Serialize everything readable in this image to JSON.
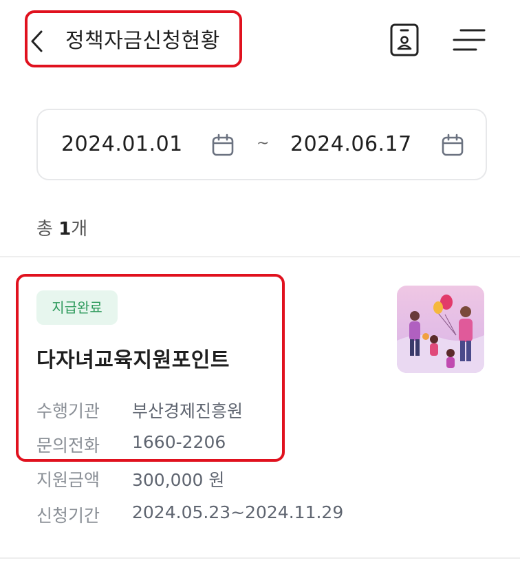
{
  "header": {
    "title": "정책자금신청현황",
    "back_icon": "chevron-left-icon",
    "id_card_icon": "id-card-icon",
    "menu_icon": "menu-icon",
    "highlight_color": "#e0111e"
  },
  "date_filter": {
    "start": "2024.01.01",
    "separator": "~",
    "end": "2024.06.17"
  },
  "summary": {
    "prefix": "총",
    "count": "1",
    "unit": "개"
  },
  "items": [
    {
      "status": "지급완료",
      "status_color": "#2e9a5c",
      "title": "다자녀교육지원포인트",
      "fields": [
        {
          "label": "수행기관",
          "value": "부산경제진흥원"
        },
        {
          "label": "문의전화",
          "value": "1660-2206"
        },
        {
          "label": "지원금액",
          "value": "300,000 원"
        },
        {
          "label": "신청기간",
          "value": "2024.05.23~2024.11.29"
        }
      ],
      "thumbnail_icon": "family-illustration"
    }
  ]
}
